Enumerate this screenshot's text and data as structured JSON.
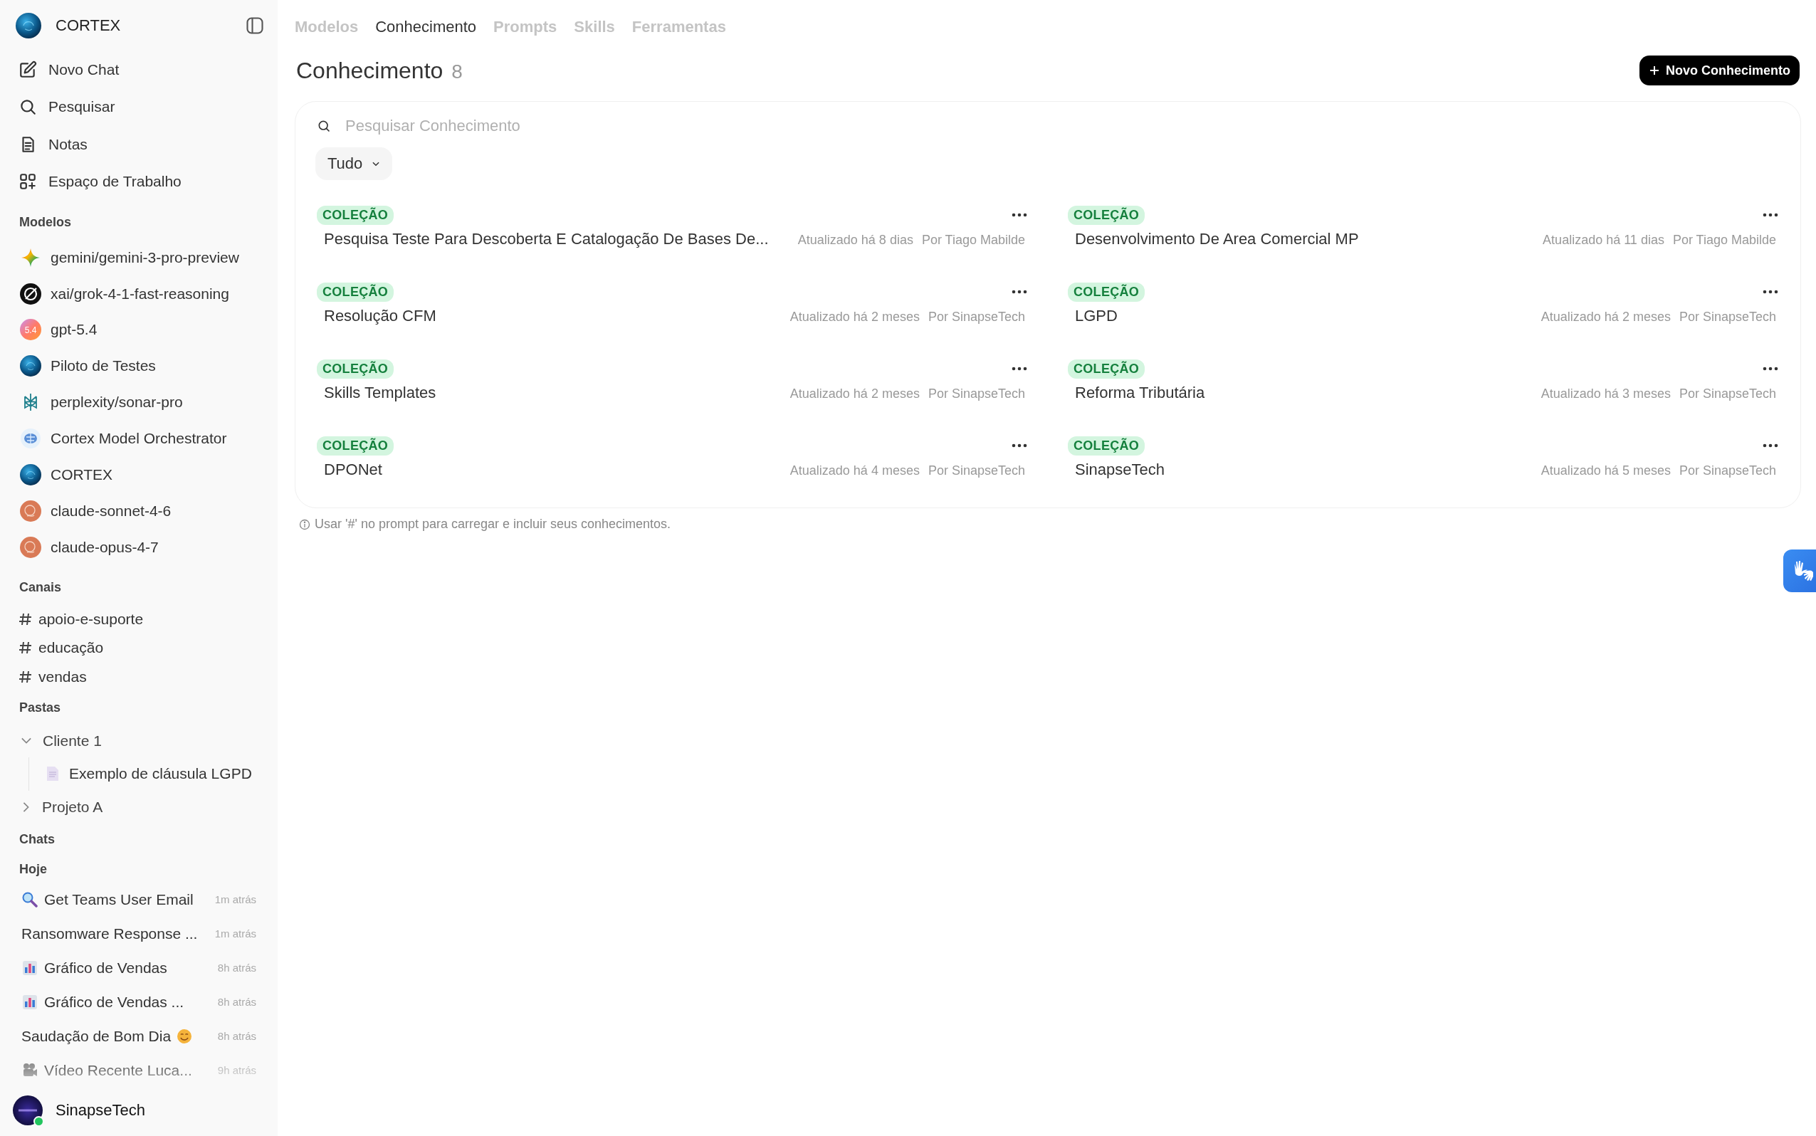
{
  "sidebar": {
    "brand": "CORTEX",
    "nav": [
      {
        "label": "Novo Chat",
        "kind": "new-chat"
      },
      {
        "label": "Pesquisar",
        "kind": "search"
      },
      {
        "label": "Notas",
        "kind": "notes"
      },
      {
        "label": "Espaço de Trabalho",
        "kind": "workspace"
      }
    ],
    "models_heading": "Modelos",
    "models": [
      {
        "name": "gemini/gemini-3-pro-preview",
        "kind": "gemini"
      },
      {
        "name": "xai/grok-4-1-fast-reasoning",
        "kind": "grok"
      },
      {
        "name": "gpt-5.4",
        "kind": "gpt",
        "badge": "5.4"
      },
      {
        "name": "Piloto de Testes",
        "kind": "cortex"
      },
      {
        "name": "perplexity/sonar-pro",
        "kind": "perplexity"
      },
      {
        "name": "Cortex Model Orchestrator",
        "kind": "orchestrator"
      },
      {
        "name": "CORTEX",
        "kind": "cortex"
      },
      {
        "name": "claude-sonnet-4-6",
        "kind": "claude"
      },
      {
        "name": "claude-opus-4-7",
        "kind": "claude"
      }
    ],
    "channels_heading": "Canais",
    "channels": [
      {
        "label": "apoio-e-suporte"
      },
      {
        "label": "educação"
      },
      {
        "label": "vendas"
      }
    ],
    "folders_heading": "Pastas",
    "folders": [
      {
        "name": "Cliente 1",
        "expanded": true,
        "children": [
          {
            "name": "Exemplo de cláusula LGPD"
          }
        ]
      },
      {
        "name": "Projeto A",
        "expanded": false
      }
    ],
    "chats_heading": "Chats",
    "chats_group": "Hoje",
    "chats": [
      {
        "title": "Get Teams User Email",
        "time": "1m atrás",
        "kind": "magnifier"
      },
      {
        "title": "Ransomware Response ...",
        "time": "1m atrás",
        "kind": "plain"
      },
      {
        "title": "Gráfico de Vendas",
        "time": "8h atrás",
        "kind": "chart"
      },
      {
        "title": "Gráfico de Vendas ...",
        "time": "8h atrás",
        "kind": "chart"
      },
      {
        "title": "Saudação de Bom Dia",
        "time": "8h atrás",
        "kind": "greeting"
      },
      {
        "title": "Vídeo Recente Luca...",
        "time": "9h atrás",
        "kind": "camera"
      }
    ],
    "user": {
      "name": "SinapseTech",
      "online": true
    }
  },
  "tabs": [
    {
      "label": "Modelos",
      "selected": false
    },
    {
      "label": "Conhecimento",
      "selected": true
    },
    {
      "label": "Prompts",
      "selected": false
    },
    {
      "label": "Skills",
      "selected": false
    },
    {
      "label": "Ferramentas",
      "selected": false
    }
  ],
  "header": {
    "title": "Conhecimento",
    "count": "8",
    "new_button": "Novo Conhecimento"
  },
  "search": {
    "placeholder": "Pesquisar Conhecimento"
  },
  "filter": {
    "value": "Tudo"
  },
  "items": [
    {
      "badge": "COLEÇÃO",
      "title": "Pesquisa Teste Para Descoberta E Catalogação De Bases De...",
      "updated": "Atualizado há 8 dias",
      "author": "Por Tiago Mabilde"
    },
    {
      "badge": "COLEÇÃO",
      "title": "Desenvolvimento De Area Comercial MP",
      "updated": "Atualizado há 11 dias",
      "author": "Por Tiago Mabilde"
    },
    {
      "badge": "COLEÇÃO",
      "title": "Resolução CFM",
      "updated": "Atualizado há 2 meses",
      "author": "Por SinapseTech"
    },
    {
      "badge": "COLEÇÃO",
      "title": "LGPD",
      "updated": "Atualizado há 2 meses",
      "author": "Por SinapseTech"
    },
    {
      "badge": "COLEÇÃO",
      "title": "Skills Templates",
      "updated": "Atualizado há 2 meses",
      "author": "Por SinapseTech"
    },
    {
      "badge": "COLEÇÃO",
      "title": "Reforma Tributária",
      "updated": "Atualizado há 3 meses",
      "author": "Por SinapseTech"
    },
    {
      "badge": "COLEÇÃO",
      "title": "DPONet",
      "updated": "Atualizado há 4 meses",
      "author": "Por SinapseTech"
    },
    {
      "badge": "COLEÇÃO",
      "title": "SinapseTech",
      "updated": "Atualizado há 5 meses",
      "author": "Por SinapseTech"
    }
  ],
  "note": "Usar '#' no prompt para carregar e incluir seus conhecimentos."
}
